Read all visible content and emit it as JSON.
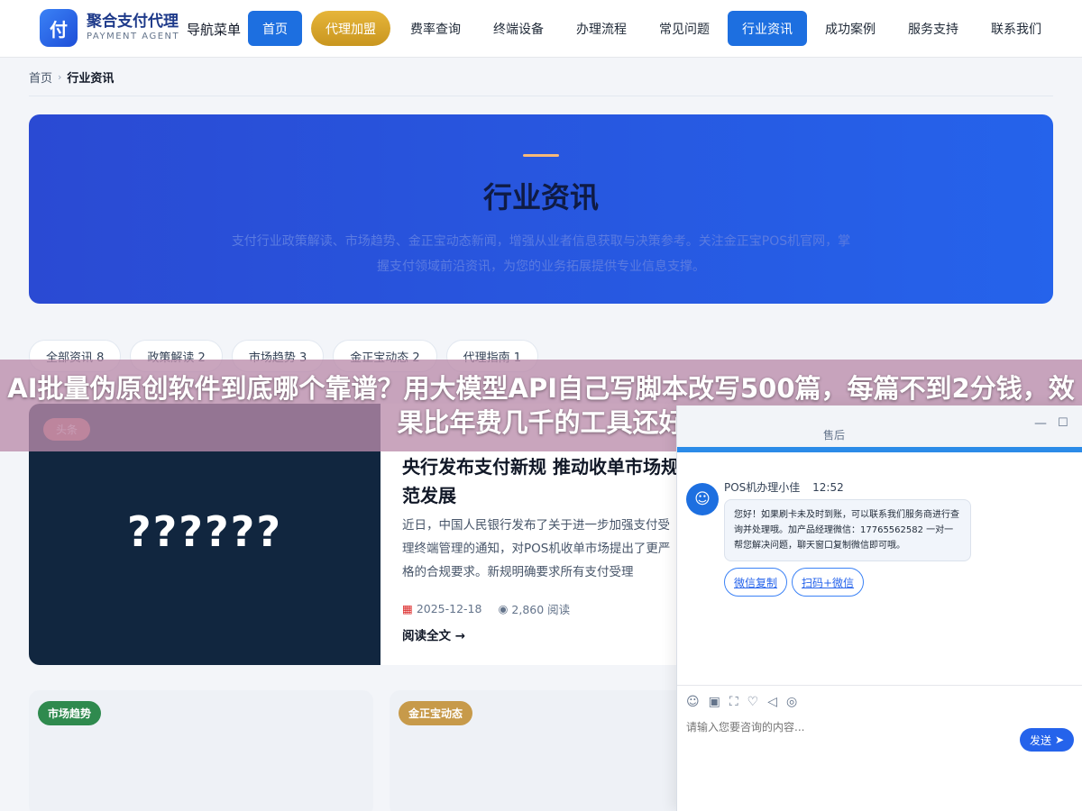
{
  "header": {
    "logo_char": "付",
    "logo_cn": "聚合支付代理",
    "logo_en": "PAYMENT AGENT",
    "menu_label": "导航菜单",
    "nav": [
      {
        "label": "首页"
      },
      {
        "label": "代理加盟"
      },
      {
        "label": "费率查询"
      },
      {
        "label": "终端设备"
      },
      {
        "label": "办理流程"
      },
      {
        "label": "常见问题"
      },
      {
        "label": "行业资讯"
      },
      {
        "label": "成功案例"
      },
      {
        "label": "服务支持"
      },
      {
        "label": "联系我们"
      }
    ]
  },
  "breadcrumb": {
    "home": "首页",
    "current": "行业资讯"
  },
  "hero": {
    "title": "行业资讯",
    "desc": "支付行业政策解读、市场趋势、金正宝动态新闻，增强从业者信息获取与决策参考。关注金正宝POS机官网，掌握支付领域前沿资讯，为您的业务拓展提供专业信息支撑。"
  },
  "filters": [
    "全部资讯 8",
    "政策解读 2",
    "市场趋势 3",
    "金正宝动态 2",
    "代理指南 1"
  ],
  "feature": {
    "tag": "头条",
    "image_text": "??????",
    "title": "央行发布支付新规 推动收单市场规范发展",
    "body": "近日，中国人民银行发布了关于进一步加强支付受理终端管理的通知，对POS机收单市场提出了更严格的合规要求。新规明确要求所有支付受理",
    "date": "2025-12-18",
    "views": "2,860 阅读",
    "read_more": "阅读全文 →"
  },
  "cards": [
    {
      "tag": "市场趋势",
      "color": "#2f8a4e"
    },
    {
      "tag": "金正宝动态",
      "color": "#c79a4a"
    }
  ],
  "banner": {
    "text": "AI批量伪原创软件到底哪个靠谱？用大模型API自己写脚本改写500篇，每篇不到2分钱，效果比年费几千的工具还好"
  },
  "chat": {
    "title": "售后",
    "agent_name": "POS机办理小佳",
    "time": "12:52",
    "message": "您好！如果刷卡未及时到账，可以联系我们服务商进行查询并处理哦。加产品经理微信：17765562582 一对一帮您解决问题，聊天窗口复制微信即可哦。",
    "quick_replies": [
      "微信复制",
      "扫码+微信"
    ],
    "input_placeholder": "请输入您要咨询的内容...",
    "send_label": "发送"
  },
  "colors": {
    "primary": "#1d6fe0",
    "gold": "#d9a52d",
    "hero_bg": "#2a4ad3",
    "feature_image_bg": "#11263f",
    "banner_overlay": "#ba8caa"
  }
}
